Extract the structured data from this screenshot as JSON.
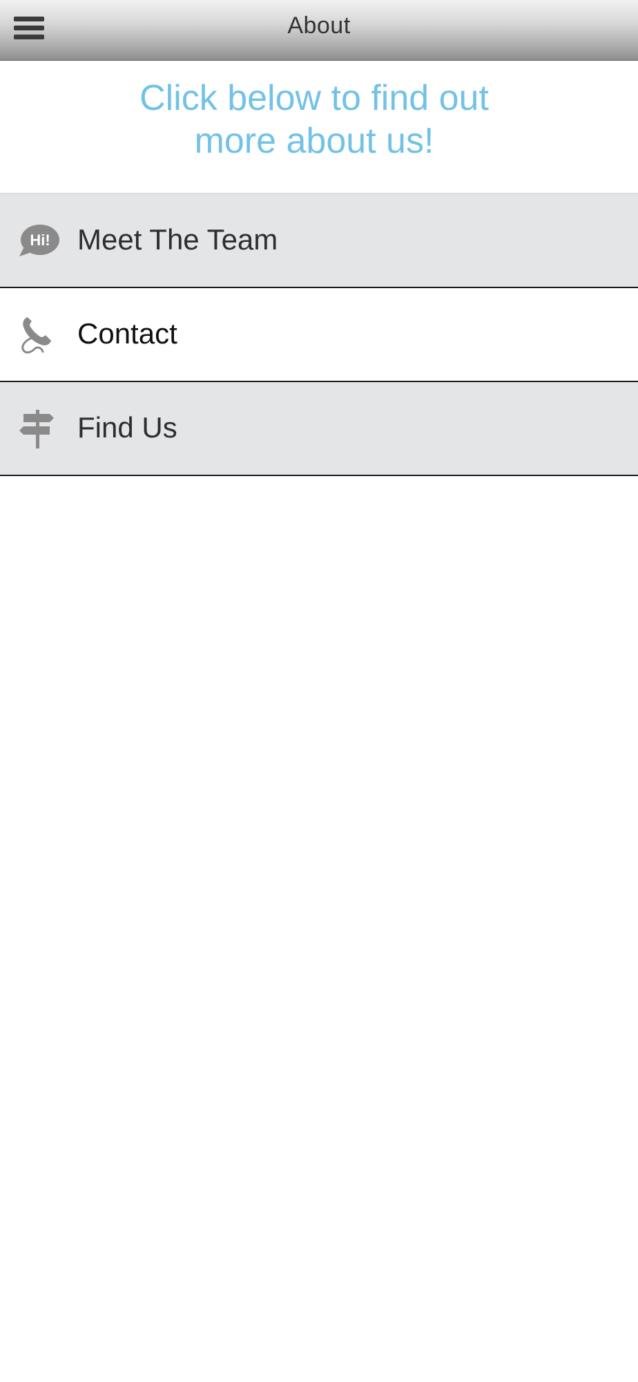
{
  "header": {
    "title": "About",
    "menu_icon": "hamburger-menu-icon"
  },
  "banner": {
    "line1": "Click below to find out",
    "line2": "more about us!",
    "color": "#72c2e6"
  },
  "list": {
    "items": [
      {
        "label": "Meet The Team",
        "icon": "speech-bubble-hi-icon"
      },
      {
        "label": "Contact",
        "icon": "telephone-handset-icon"
      },
      {
        "label": "Find Us",
        "icon": "signpost-icon"
      }
    ]
  },
  "icon_hi_text": "Hi!"
}
